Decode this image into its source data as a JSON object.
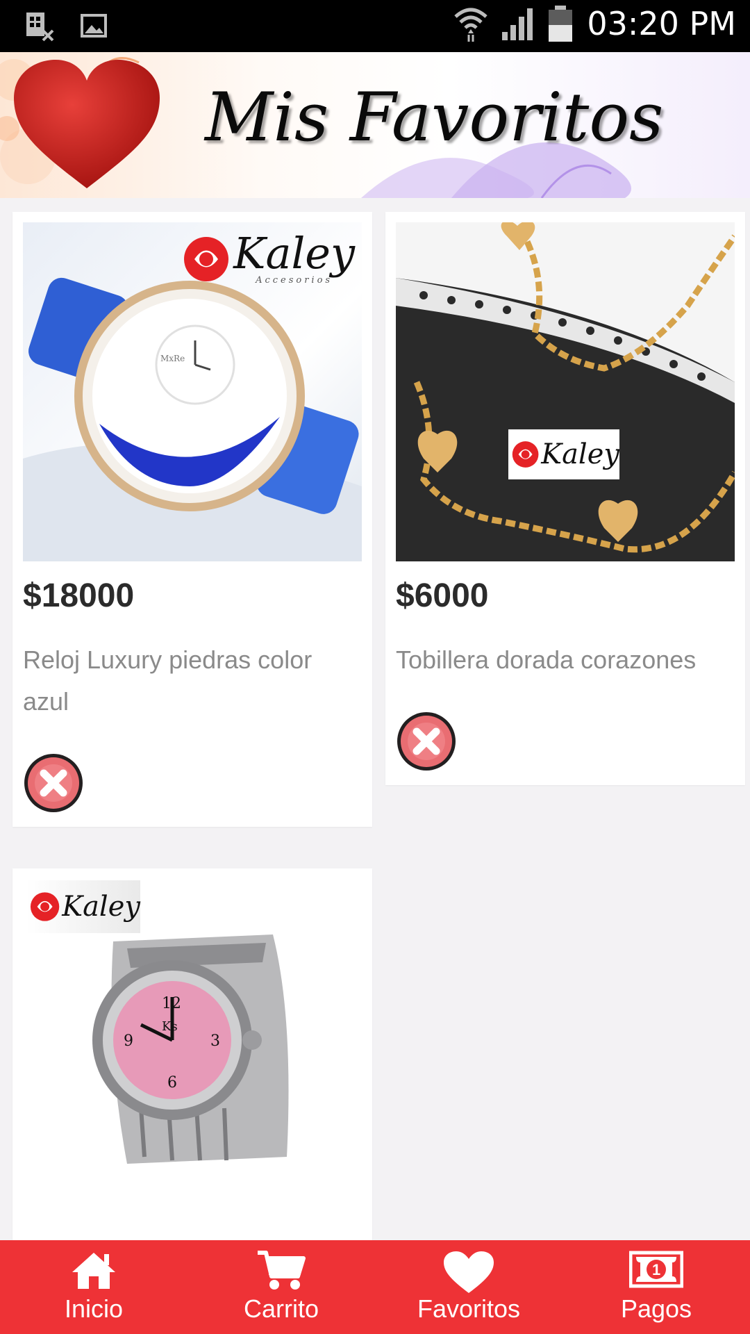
{
  "status_bar": {
    "time": "03:20 PM"
  },
  "header": {
    "title": "Mis Favoritos"
  },
  "brand": {
    "logo_text": "Kaley",
    "logo_sub": "Accesorios",
    "accent": "#ee3236"
  },
  "favorites": [
    {
      "price": "$18000",
      "name": "Reloj Luxury piedras color azul",
      "image": "blue-watch-image"
    },
    {
      "price": "$6000",
      "name": "Tobillera dorada corazones",
      "image": "gold-anklet-image"
    },
    {
      "price": "",
      "name": "",
      "image": "ring-watch-image"
    }
  ],
  "bottom_nav": {
    "items": [
      {
        "label": "Inicio",
        "icon": "home-icon"
      },
      {
        "label": "Carrito",
        "icon": "cart-icon"
      },
      {
        "label": "Favoritos",
        "icon": "heart-icon"
      },
      {
        "label": "Pagos",
        "icon": "money-icon"
      }
    ]
  }
}
